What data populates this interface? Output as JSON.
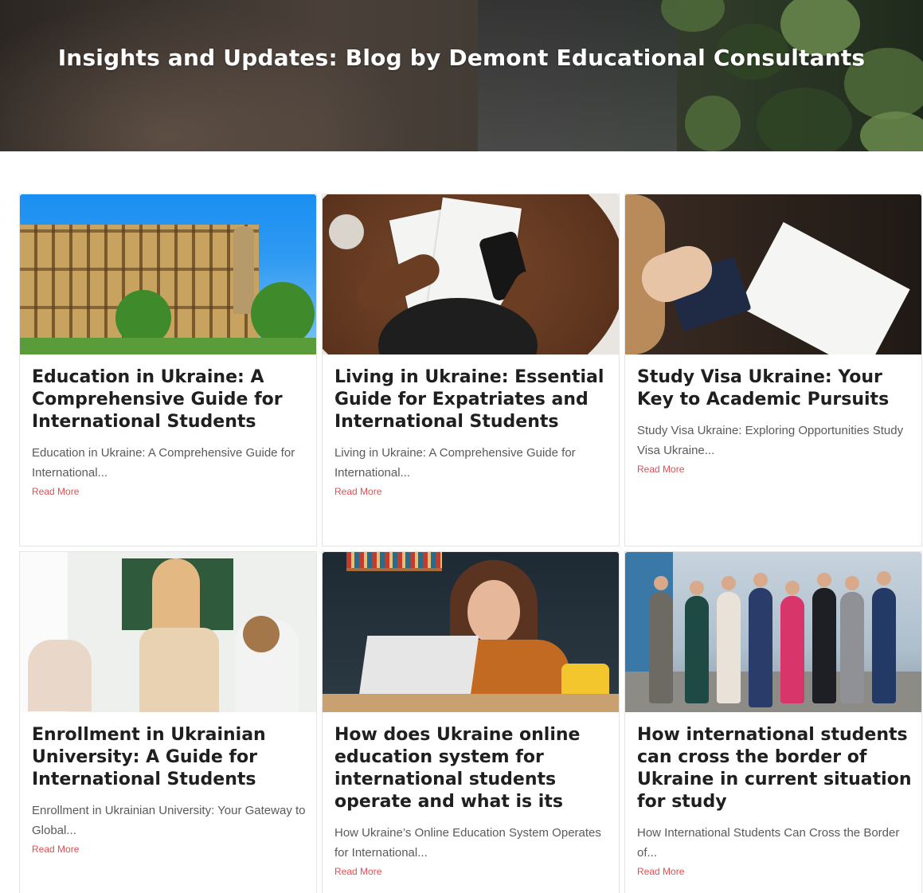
{
  "hero": {
    "title": "Insights and Updates: Blog by Demont Educational Consultants"
  },
  "posts": [
    {
      "title": "Education in Ukraine: A Comprehensive Guide for International Students",
      "excerpt": "Education in Ukraine: A Comprehensive Guide for International...",
      "link": "Read More"
    },
    {
      "title": "Living in Ukraine: Essential Guide for Expatriates and International Students",
      "excerpt": "Living in Ukraine: A Comprehensive Guide for International...",
      "link": "Read More"
    },
    {
      "title": "Study Visa Ukraine: Your Key to Academic Pursuits",
      "excerpt": "Study Visa Ukraine: Exploring Opportunities Study Visa Ukraine...",
      "link": "Read More"
    },
    {
      "title": "Enrollment in Ukrainian University: A Guide for International Students",
      "excerpt": "Enrollment in Ukrainian University: Your Gateway to Global...",
      "link": "Read More"
    },
    {
      "title": "How does Ukraine online education system for international students operate and what is its",
      "excerpt": "How Ukraine’s Online Education System Operates for International...",
      "link": "Read More"
    },
    {
      "title": "How international students can cross the border of Ukraine in current situation for study",
      "excerpt": "How International Students Can Cross the Border of...",
      "link": "Read More"
    }
  ],
  "colors": {
    "link": "#e04e52",
    "title": "#1f1f1f",
    "excerpt": "#5a5a5a"
  }
}
